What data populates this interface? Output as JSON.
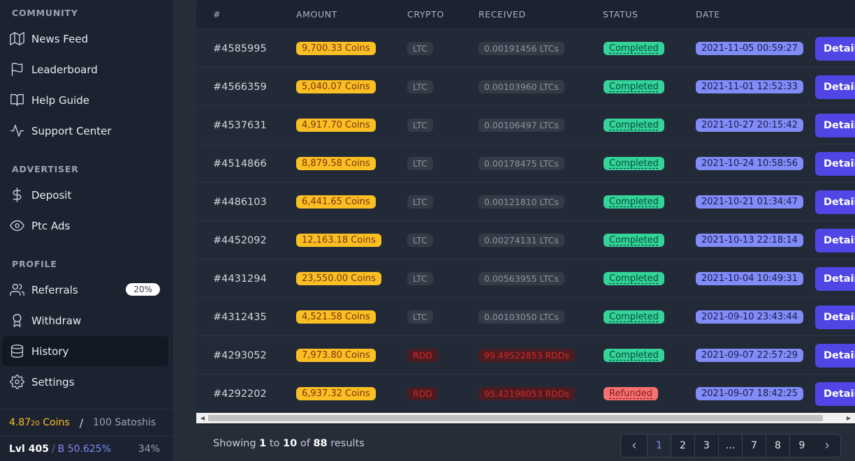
{
  "sidebar": {
    "community_title": "COMMUNITY",
    "advertiser_title": "ADVERTISER",
    "profile_title": "PROFILE",
    "items": [
      {
        "label": "News Feed",
        "icon": "map-icon"
      },
      {
        "label": "Leaderboard",
        "icon": "flag-icon"
      },
      {
        "label": "Help Guide",
        "icon": "book-icon"
      },
      {
        "label": "Support Center",
        "icon": "activity-icon"
      },
      {
        "label": "Deposit",
        "icon": "dollar-icon"
      },
      {
        "label": "Ptc Ads",
        "icon": "eye-icon"
      },
      {
        "label": "Referrals",
        "icon": "users-icon",
        "badge": "20%"
      },
      {
        "label": "Withdraw",
        "icon": "award-icon"
      },
      {
        "label": "History",
        "icon": "database-icon",
        "active": true
      },
      {
        "label": "Settings",
        "icon": "gear-icon"
      }
    ],
    "balance": {
      "coins_main": "4.87",
      "coins_small": "20",
      "coins_unit": " Coins",
      "sep": "/",
      "satoshi": "100 Satoshis"
    },
    "level": {
      "lvl": "Lvl 405",
      "sep": "/",
      "boost": "B 50.625%",
      "pct": "34%"
    }
  },
  "table": {
    "headers": {
      "id": "#",
      "amount": "AMOUNT",
      "crypto": "CRYPTO",
      "received": "RECEIVED",
      "status": "STATUS",
      "date": "DATE"
    },
    "details_label": "Details",
    "rows": [
      {
        "id": "#4585995",
        "amount": "9,700.33 Coins",
        "crypto": "LTC",
        "received": "0.00191456 LTCs",
        "status": "Completed",
        "date": "2021-11-05 00:59:27"
      },
      {
        "id": "#4566359",
        "amount": "5,040.07 Coins",
        "crypto": "LTC",
        "received": "0.00103960 LTCs",
        "status": "Completed",
        "date": "2021-11-01 12:52:33"
      },
      {
        "id": "#4537631",
        "amount": "4,917.70 Coins",
        "crypto": "LTC",
        "received": "0.00106497 LTCs",
        "status": "Completed",
        "date": "2021-10-27 20:15:42"
      },
      {
        "id": "#4514866",
        "amount": "8,879.58 Coins",
        "crypto": "LTC",
        "received": "0.00178475 LTCs",
        "status": "Completed",
        "date": "2021-10-24 10:58:56"
      },
      {
        "id": "#4486103",
        "amount": "6,441.65 Coins",
        "crypto": "LTC",
        "received": "0.00121810 LTCs",
        "status": "Completed",
        "date": "2021-10-21 01:34:47"
      },
      {
        "id": "#4452092",
        "amount": "12,163.18 Coins",
        "crypto": "LTC",
        "received": "0.00274131 LTCs",
        "status": "Completed",
        "date": "2021-10-13 22:18:14"
      },
      {
        "id": "#4431294",
        "amount": "23,550.00 Coins",
        "crypto": "LTC",
        "received": "0.00563955 LTCs",
        "status": "Completed",
        "date": "2021-10-04 10:49:31"
      },
      {
        "id": "#4312435",
        "amount": "4,521.58 Coins",
        "crypto": "LTC",
        "received": "0.00103050 LTCs",
        "status": "Completed",
        "date": "2021-09-10 23:43:44"
      },
      {
        "id": "#4293052",
        "amount": "7,973.80 Coins",
        "crypto": "RDD",
        "received": "99.49522853 RDDs",
        "status": "Completed",
        "date": "2021-09-07 22:57:29"
      },
      {
        "id": "#4292202",
        "amount": "6,937.32 Coins",
        "crypto": "RDD",
        "received": "95.42198053 RDDs",
        "status": "Refunded",
        "date": "2021-09-07 18:42:25"
      }
    ]
  },
  "footer": {
    "showing_prefix": "Showing",
    "from": "1",
    "to_word": "to",
    "to": "10",
    "of_word": "of",
    "total": "88",
    "suffix": "results"
  },
  "pagination": {
    "pages": [
      "1",
      "2",
      "3",
      "...",
      "7",
      "8",
      "9"
    ],
    "current": "1"
  },
  "colors": {
    "amount_bg": "#fbbf24",
    "completed_bg": "#34d399",
    "refunded_bg": "#f87171",
    "date_bg": "#818cf8",
    "details_bg": "#4f46e5"
  }
}
